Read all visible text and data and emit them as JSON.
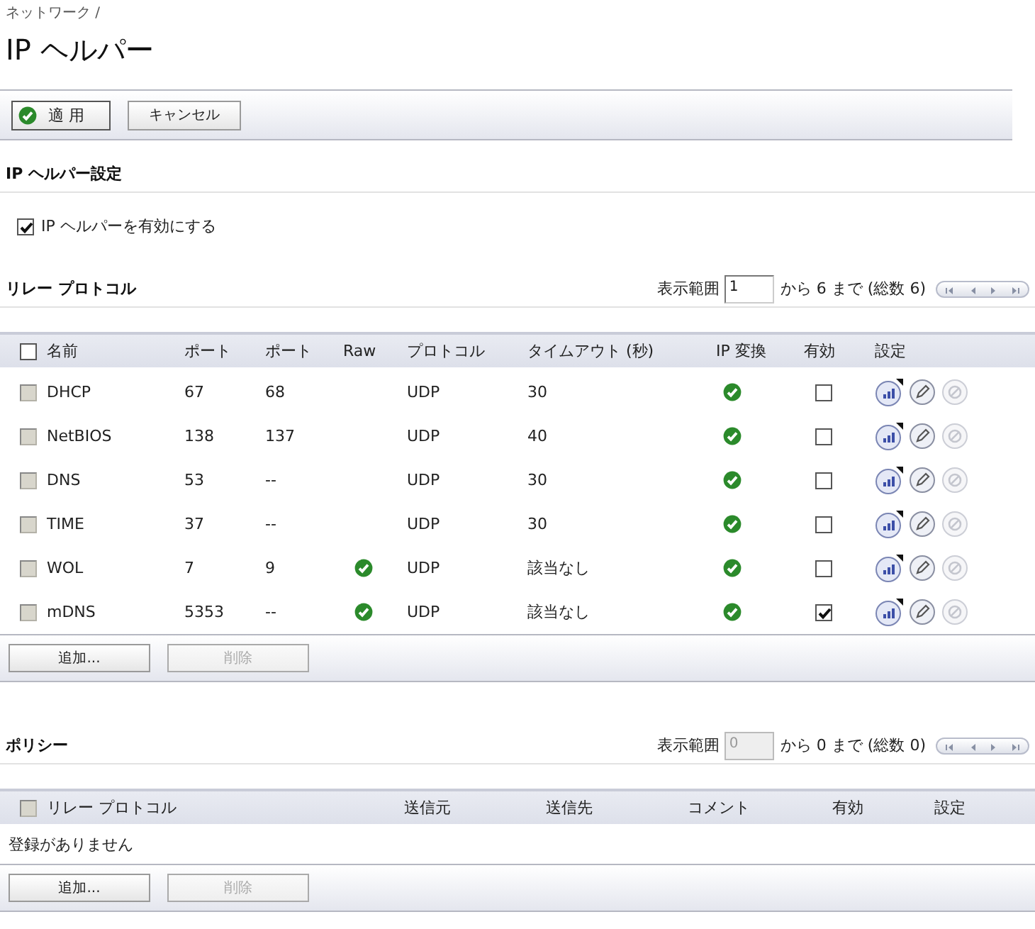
{
  "breadcrumb": "ネットワーク /",
  "title": "IP ヘルパー",
  "toolbar": [
    {
      "label": "適 用",
      "kind": "apply"
    },
    {
      "label": "キャンセル",
      "kind": "plain"
    }
  ],
  "settings": {
    "heading": "IP ヘルパー設定",
    "checkbox": {
      "label": "IP ヘルパーを有効にする",
      "checked": true
    }
  },
  "relay": {
    "heading": "リレー プロトコル",
    "pager": {
      "label": "表示範囲",
      "value": "1",
      "range": "から 6 まで (総数 6)",
      "disabled": false
    },
    "select_all": {
      "disabled": false
    },
    "columns": [
      "名前",
      "ポート",
      "ポート",
      "Raw",
      "プロトコル",
      "タイムアウト (秒)",
      "IP 変換",
      "有効",
      "設定"
    ],
    "rows": [
      {
        "name": "DHCP",
        "port_1": "67",
        "port_2": "68",
        "raw": false,
        "protocol": "UDP",
        "timeout": "30",
        "ip_translation": true,
        "enabled": false,
        "checkbox_disabled": true
      },
      {
        "name": "NetBIOS",
        "port_1": "138",
        "port_2": "137",
        "raw": false,
        "protocol": "UDP",
        "timeout": "40",
        "ip_translation": true,
        "enabled": false,
        "checkbox_disabled": true
      },
      {
        "name": "DNS",
        "port_1": "53",
        "port_2": "--",
        "raw": false,
        "protocol": "UDP",
        "timeout": "30",
        "ip_translation": true,
        "enabled": false,
        "checkbox_disabled": true
      },
      {
        "name": "TIME",
        "port_1": "37",
        "port_2": "--",
        "raw": false,
        "protocol": "UDP",
        "timeout": "30",
        "ip_translation": true,
        "enabled": false,
        "checkbox_disabled": true
      },
      {
        "name": "WOL",
        "port_1": "7",
        "port_2": "9",
        "raw": true,
        "protocol": "UDP",
        "timeout": "該当なし",
        "ip_translation": true,
        "enabled": false,
        "checkbox_disabled": true
      },
      {
        "name": "mDNS",
        "port_1": "5353",
        "port_2": "--",
        "raw": true,
        "protocol": "UDP",
        "timeout": "該当なし",
        "ip_translation": true,
        "enabled": true,
        "checkbox_disabled": true
      }
    ],
    "buttons": [
      {
        "label": "追加...",
        "disabled": false
      },
      {
        "label": "削除",
        "disabled": true
      }
    ]
  },
  "policy": {
    "heading": "ポリシー",
    "pager": {
      "label": "表示範囲",
      "value": "0",
      "range": "から 0 まで (総数 0)",
      "disabled": true
    },
    "select_all": {
      "disabled": true
    },
    "columns": [
      "リレー プロトコル",
      "送信元",
      "送信先",
      "コメント",
      "有効",
      "設定"
    ],
    "empty_message": "登録がありません",
    "buttons": [
      {
        "label": "追加...",
        "disabled": false
      },
      {
        "label": "削除",
        "disabled": true
      }
    ]
  }
}
